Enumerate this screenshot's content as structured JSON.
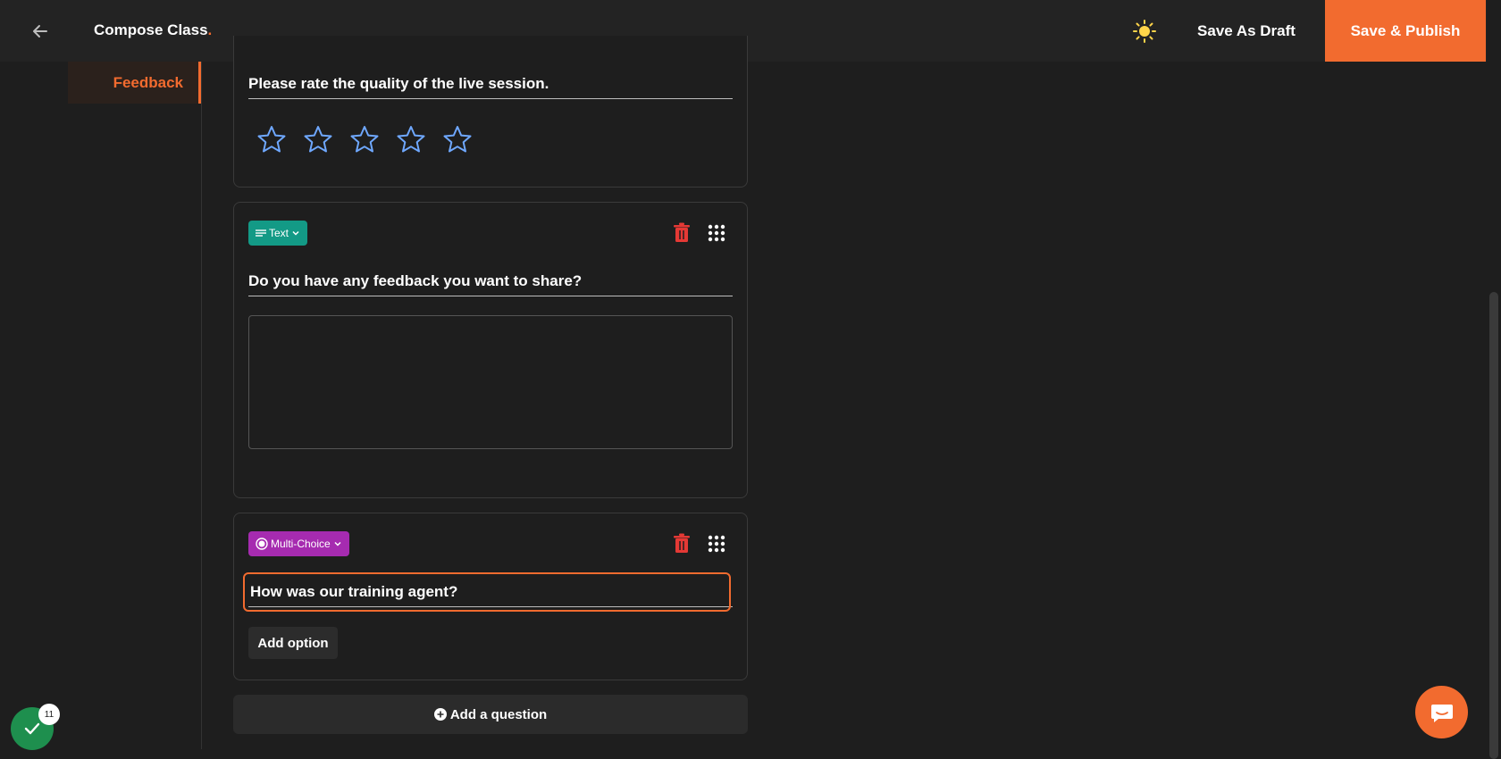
{
  "header": {
    "title": "Compose Class",
    "title_dot": ".",
    "save_draft_label": "Save As Draft",
    "publish_label": "Save & Publish",
    "accent_color": "#f26b2f"
  },
  "sidebar": {
    "active_item": "Feedback"
  },
  "questions": [
    {
      "title": "Please rate the quality of the live session.",
      "type": "Rating",
      "stars": 5
    },
    {
      "type_label": "Text",
      "title": "Do you have any feedback you want to share?"
    },
    {
      "type_label": "Multi-Choice",
      "title": "How was our training agent?",
      "add_option_label": "Add option"
    }
  ],
  "add_question_label": "Add a question",
  "notification_count": "11",
  "icons": {
    "back": "arrow-left-icon",
    "theme": "sun-icon",
    "delete": "trash-icon",
    "drag": "grid-dots-icon",
    "chat": "chat-icon"
  }
}
